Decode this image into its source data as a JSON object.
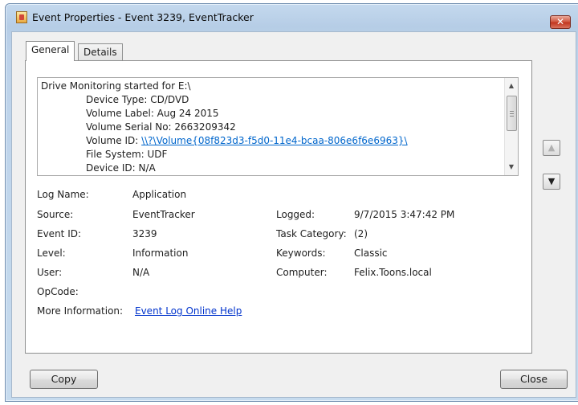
{
  "window": {
    "title": "Event Properties - Event 3239, EventTracker",
    "close_glyph": "✕"
  },
  "tabs": [
    {
      "label": "General",
      "selected": true
    },
    {
      "label": "Details",
      "selected": false
    }
  ],
  "description": {
    "lines": [
      {
        "text": "Drive Monitoring started for E:\\",
        "indent": 0
      },
      {
        "text": "Device Type: CD/DVD",
        "indent": 1
      },
      {
        "text": "Volume Label: Aug 24 2015",
        "indent": 1
      },
      {
        "text": "Volume Serial No: 2663209342",
        "indent": 1
      },
      {
        "label": "Volume ID: ",
        "link": "\\\\?\\Volume{08f823d3-f5d0-11e4-bcaa-806e6f6e6963}\\",
        "indent": 1
      },
      {
        "text": "File System: UDF",
        "indent": 1
      },
      {
        "text": "Device ID: N/A",
        "indent": 1
      }
    ],
    "scrollbar": {
      "up_arrow": "▲",
      "down_arrow": "▼"
    }
  },
  "fields": {
    "log_name": {
      "label": "Log Name:",
      "value": "Application"
    },
    "source": {
      "label": "Source:",
      "value": "EventTracker"
    },
    "logged": {
      "label": "Logged:",
      "value": "9/7/2015 3:47:42 PM"
    },
    "event_id": {
      "label": "Event ID:",
      "value": "3239"
    },
    "task_category": {
      "label": "Task Category:",
      "value": "(2)"
    },
    "level": {
      "label": "Level:",
      "value": "Information"
    },
    "keywords": {
      "label": "Keywords:",
      "value": "Classic"
    },
    "user": {
      "label": "User:",
      "value": "N/A"
    },
    "computer": {
      "label": "Computer:",
      "value": "Felix.Toons.local"
    },
    "opcode": {
      "label": "OpCode:",
      "value": ""
    },
    "more_info": {
      "label": "More Information:",
      "value": "Event Log Online Help"
    }
  },
  "nav": {
    "previous_icon": "previous-event-icon",
    "next_icon": "next-event-icon",
    "previous_glyph": "▲",
    "next_glyph": "▼"
  },
  "buttons": {
    "copy": "Copy",
    "close": "Close"
  },
  "colors": {
    "link": "#0066cc",
    "close_button": "#c2361f"
  }
}
